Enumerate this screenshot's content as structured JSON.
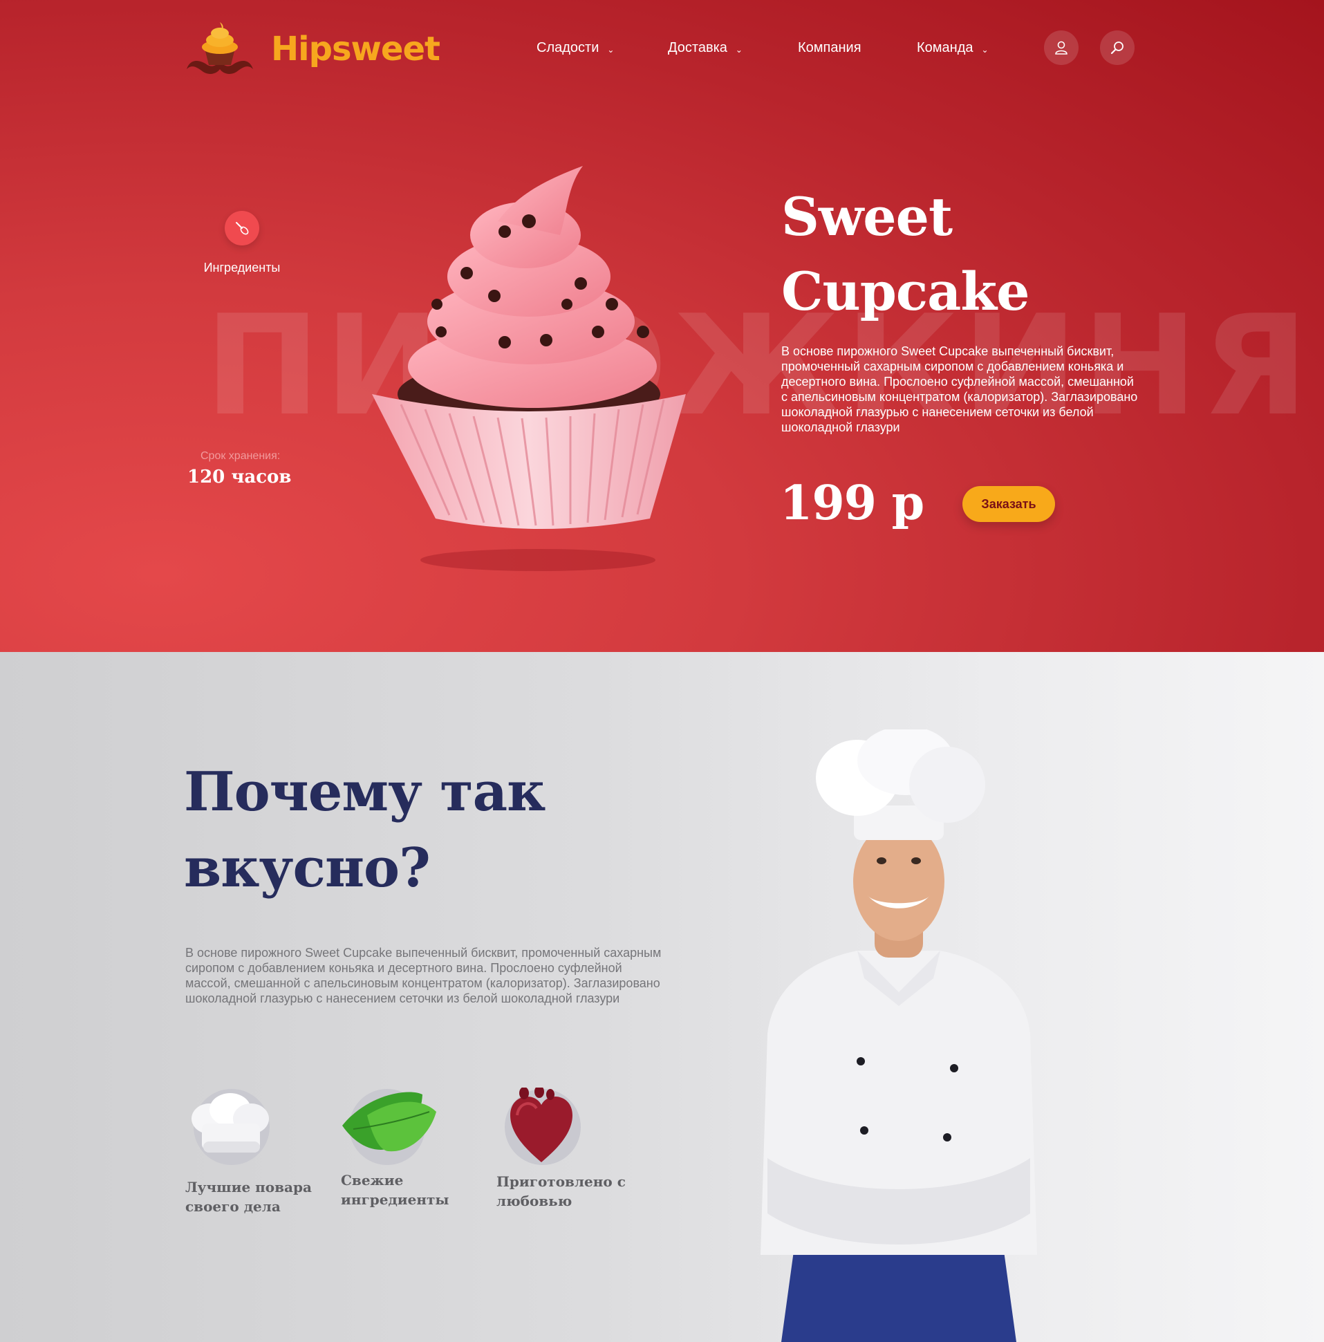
{
  "brand": {
    "name": "Hipsweet"
  },
  "nav": {
    "items": [
      {
        "label": "Сладости",
        "has_dropdown": true
      },
      {
        "label": "Доставка",
        "has_dropdown": true
      },
      {
        "label": "Компания",
        "has_dropdown": false
      },
      {
        "label": "Команда",
        "has_dropdown": true
      }
    ],
    "chevron": "⌄"
  },
  "hero": {
    "watermark": "ПИРОЖКИНЯ",
    "ingredients_label": "Ингредиенты",
    "shelf_life_label": "Срок хранения:",
    "shelf_life_value": "120 часов",
    "title_line1": "Sweet",
    "title_line2": "Cupcake",
    "description": "В основе пирожного Sweet Cupcake выпеченный бисквит, промоченный сахарным сиропом с добавлением коньяка и десертного вина. Прослоено суфлейной массой, смешанной с апельсиновым концентратом (калоризатор). Заглазировано шоколадной глазурью с нанесением сеточки из белой шоколадной глазури",
    "price": "199 р",
    "order_button": "Заказать"
  },
  "why": {
    "title_line1": "Почему так",
    "title_line2": "вкусно?",
    "description": "В основе пирожного Sweet Cupcake выпеченный бисквит, промоченный сахарным сиропом с добавлением коньяка и десертного вина. Прослоено суфлейной массой, смешанной с апельсиновым концентратом (калоризатор). Заглазировано шоколадной глазурью с нанесением сеточки из белой шоколадной глазури",
    "features": [
      {
        "line1": "Лучшие повара",
        "line2": "своего дела",
        "icon": "chef-hat-icon"
      },
      {
        "line1": "Свежие",
        "line2": "ингредиенты",
        "icon": "leaf-icon"
      },
      {
        "line1": "Приготовлено с",
        "line2": "любовью",
        "icon": "heart-icon"
      }
    ]
  },
  "colors": {
    "hero_red": "#c92c33",
    "accent_orange": "#f8a91a",
    "title_navy": "#262c5c",
    "text_gray": "#757579"
  },
  "icons": [
    "user-icon",
    "search-icon",
    "whisk-icon"
  ]
}
